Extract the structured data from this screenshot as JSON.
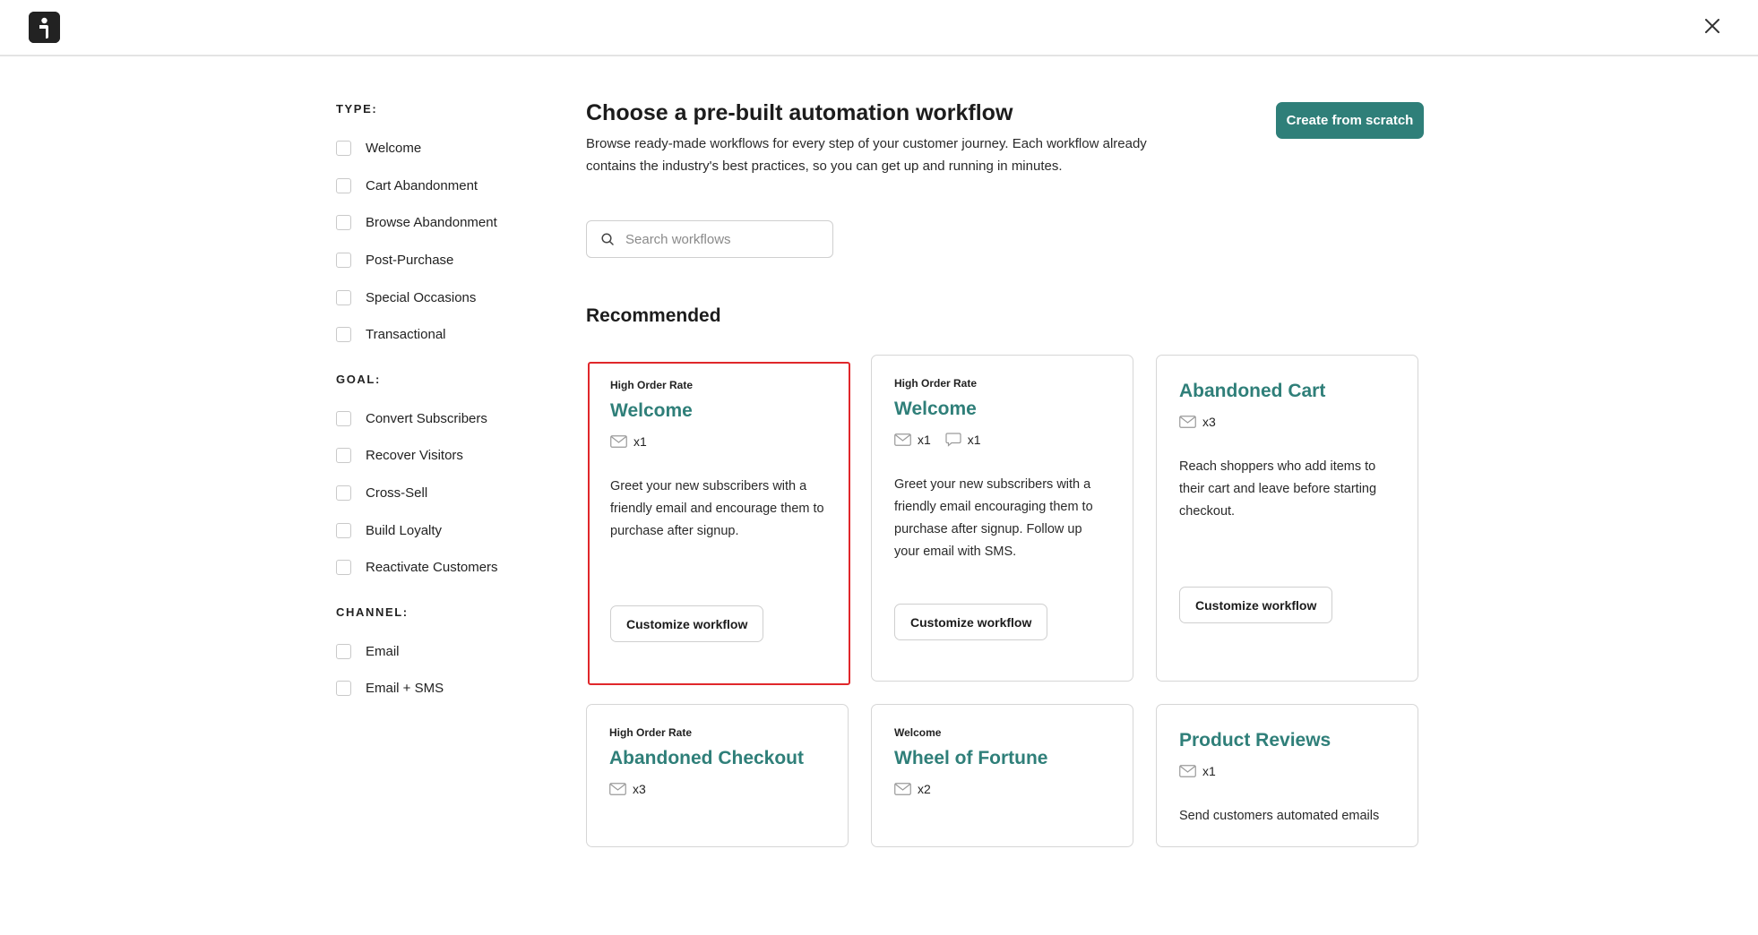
{
  "header": {
    "logo_icon": "brand-logo-icon",
    "close_icon": "close-icon"
  },
  "sidebar": {
    "groups": [
      {
        "title": "TYPE:",
        "items": [
          "Welcome",
          "Cart Abandonment",
          "Browse Abandonment",
          "Post-Purchase",
          "Special Occasions",
          "Transactional"
        ]
      },
      {
        "title": "GOAL:",
        "items": [
          "Convert Subscribers",
          "Recover Visitors",
          "Cross-Sell",
          "Build Loyalty",
          "Reactivate Customers"
        ]
      },
      {
        "title": "CHANNEL:",
        "items": [
          "Email",
          "Email + SMS"
        ]
      }
    ]
  },
  "main": {
    "title": "Choose a pre-built automation workflow",
    "description": "Browse ready-made workflows for every step of your customer journey. Each workflow already contains the industry's best practices, so you can get up and running in minutes.",
    "create_button": "Create from scratch",
    "search": {
      "placeholder": "Search workflows",
      "value": ""
    },
    "section_title": "Recommended"
  },
  "cards": [
    {
      "tag": "High Order Rate",
      "title": "Welcome",
      "channels": [
        {
          "icon": "mail-icon",
          "count": "x1"
        }
      ],
      "description": "Greet your new subscribers with a friendly email and encourage them to purchase after signup.",
      "button": "Customize workflow",
      "selected": true
    },
    {
      "tag": "High Order Rate",
      "title": "Welcome",
      "channels": [
        {
          "icon": "mail-icon",
          "count": "x1"
        },
        {
          "icon": "sms-icon",
          "count": "x1"
        }
      ],
      "description": "Greet your new subscribers with a friendly email encouraging them to purchase after signup. Follow up your email with SMS.",
      "button": "Customize workflow",
      "selected": false
    },
    {
      "tag": "",
      "title": "Abandoned Cart",
      "channels": [
        {
          "icon": "mail-icon",
          "count": "x3"
        }
      ],
      "description": "Reach shoppers who add items to their cart and leave before starting checkout.",
      "button": "Customize workflow",
      "selected": false
    },
    {
      "tag": "High Order Rate",
      "title": "Abandoned Checkout",
      "channels": [
        {
          "icon": "mail-icon",
          "count": "x3"
        }
      ],
      "description": "",
      "button": "",
      "selected": false
    },
    {
      "tag": "Welcome",
      "title": "Wheel of Fortune",
      "channels": [
        {
          "icon": "mail-icon",
          "count": "x2"
        }
      ],
      "description": "",
      "button": "",
      "selected": false
    },
    {
      "tag": "",
      "title": "Product Reviews",
      "channels": [
        {
          "icon": "mail-icon",
          "count": "x1"
        }
      ],
      "description": "Send customers automated emails",
      "button": "",
      "selected": false
    }
  ],
  "colors": {
    "accent": "#2f7f79",
    "selection_outline": "#e0272b"
  }
}
